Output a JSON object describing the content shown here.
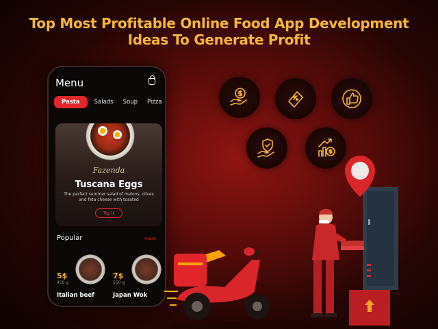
{
  "headline": {
    "line1": "Top Most Profitable Online Food App Development",
    "line2": "Ideas To Generate Profit"
  },
  "app": {
    "title": "Menu",
    "tabs": [
      {
        "label": "Pasta",
        "active": true
      },
      {
        "label": "Salads",
        "active": false
      },
      {
        "label": "Soup",
        "active": false
      },
      {
        "label": "Pizza",
        "active": false
      }
    ],
    "featured": {
      "brand": "Fazenda",
      "dish": "Tuscana Eggs",
      "description": "The perfect summer salad of melons, olives and feta cheese with toasted",
      "cta": "Try it"
    },
    "popular": {
      "heading": "Popular",
      "more": "more",
      "items": [
        {
          "price": "5$",
          "sub": "450 g",
          "name": "Italian beef"
        },
        {
          "price": "7$",
          "sub": "550 g",
          "name": "Japan Wok"
        }
      ]
    }
  },
  "icons": [
    {
      "name": "hand-dollar-icon"
    },
    {
      "name": "discount-ticket-icon"
    },
    {
      "name": "thumbs-up-icon"
    },
    {
      "name": "hand-shield-icon"
    },
    {
      "name": "growth-dollar-icon"
    }
  ],
  "colors": {
    "accent_gold": "#f4b73a",
    "brand_red": "#e2262c",
    "background_dark": "#260604"
  }
}
